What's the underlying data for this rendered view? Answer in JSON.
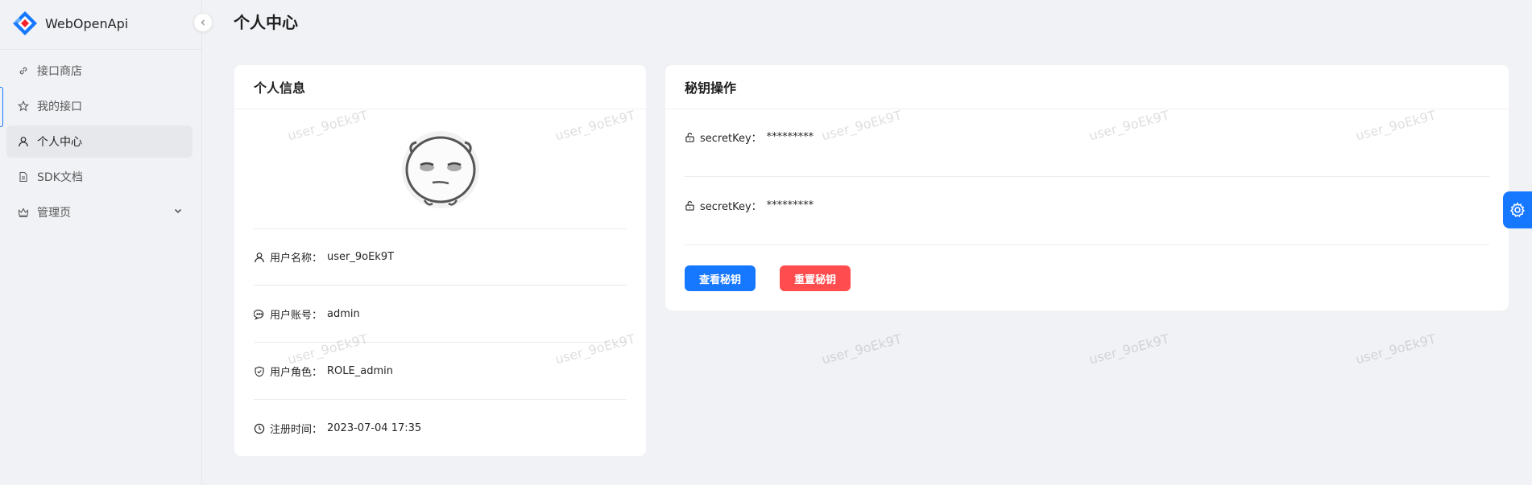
{
  "app": {
    "title": "WebOpenApi"
  },
  "sidebar": {
    "items": [
      {
        "label": "接口商店",
        "icon": "link-icon"
      },
      {
        "label": "我的接口",
        "icon": "star-icon"
      },
      {
        "label": "个人中心",
        "icon": "user-icon",
        "active": true
      },
      {
        "label": "SDK文档",
        "icon": "file-icon"
      },
      {
        "label": "管理页",
        "icon": "crown-icon",
        "expandable": true
      }
    ]
  },
  "header": {
    "title": "个人中心"
  },
  "profile_card": {
    "title": "个人信息",
    "fields": [
      {
        "label": "用户名称：",
        "value": "user_9oEk9T",
        "icon": "user-icon"
      },
      {
        "label": "用户账号：",
        "value": "admin",
        "icon": "comment-icon"
      },
      {
        "label": "用户角色：",
        "value": "ROLE_admin",
        "icon": "shield-icon"
      },
      {
        "label": "注册时间：",
        "value": "2023-07-04 17:35",
        "icon": "clock-icon"
      }
    ]
  },
  "secret_card": {
    "title": "秘钥操作",
    "keys": [
      {
        "label": "secretKey：",
        "value": "*********"
      },
      {
        "label": "secretKey：",
        "value": "*********"
      }
    ],
    "view_button": "查看秘钥",
    "reset_button": "重置秘钥"
  },
  "watermark": "user_9oEk9T",
  "colors": {
    "primary": "#1677ff",
    "danger": "#ff4d4f"
  }
}
